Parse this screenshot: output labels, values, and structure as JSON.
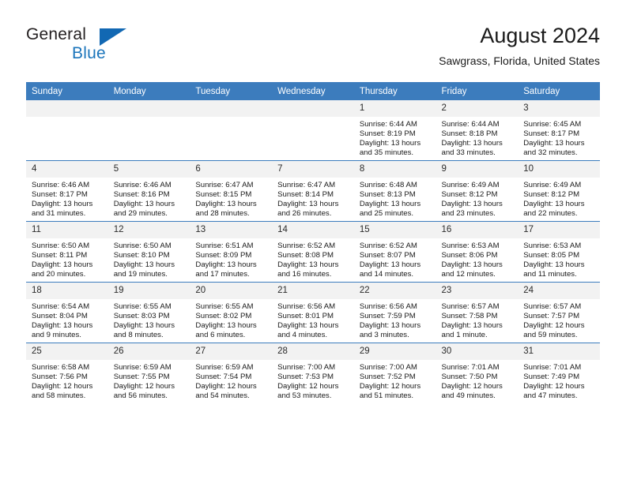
{
  "logo": {
    "word1": "General",
    "word2": "Blue",
    "triangle_color": "#1268b3",
    "blue_color": "#1b75bb"
  },
  "header": {
    "title": "August 2024",
    "subtitle": "Sawgrass, Florida, United States"
  },
  "theme": {
    "header_bar": "#3c7cbd",
    "daynum_band": "#f2f2f2",
    "text": "#1a1a1a"
  },
  "weekdays": [
    "Sunday",
    "Monday",
    "Tuesday",
    "Wednesday",
    "Thursday",
    "Friday",
    "Saturday"
  ],
  "weeks": [
    [
      {
        "day": "",
        "sunrise": "",
        "sunset": "",
        "daylight": "",
        "empty": true
      },
      {
        "day": "",
        "sunrise": "",
        "sunset": "",
        "daylight": "",
        "empty": true
      },
      {
        "day": "",
        "sunrise": "",
        "sunset": "",
        "daylight": "",
        "empty": true
      },
      {
        "day": "",
        "sunrise": "",
        "sunset": "",
        "daylight": "",
        "empty": true
      },
      {
        "day": "1",
        "sunrise": "Sunrise: 6:44 AM",
        "sunset": "Sunset: 8:19 PM",
        "daylight": "Daylight: 13 hours and 35 minutes."
      },
      {
        "day": "2",
        "sunrise": "Sunrise: 6:44 AM",
        "sunset": "Sunset: 8:18 PM",
        "daylight": "Daylight: 13 hours and 33 minutes."
      },
      {
        "day": "3",
        "sunrise": "Sunrise: 6:45 AM",
        "sunset": "Sunset: 8:17 PM",
        "daylight": "Daylight: 13 hours and 32 minutes."
      }
    ],
    [
      {
        "day": "4",
        "sunrise": "Sunrise: 6:46 AM",
        "sunset": "Sunset: 8:17 PM",
        "daylight": "Daylight: 13 hours and 31 minutes."
      },
      {
        "day": "5",
        "sunrise": "Sunrise: 6:46 AM",
        "sunset": "Sunset: 8:16 PM",
        "daylight": "Daylight: 13 hours and 29 minutes."
      },
      {
        "day": "6",
        "sunrise": "Sunrise: 6:47 AM",
        "sunset": "Sunset: 8:15 PM",
        "daylight": "Daylight: 13 hours and 28 minutes."
      },
      {
        "day": "7",
        "sunrise": "Sunrise: 6:47 AM",
        "sunset": "Sunset: 8:14 PM",
        "daylight": "Daylight: 13 hours and 26 minutes."
      },
      {
        "day": "8",
        "sunrise": "Sunrise: 6:48 AM",
        "sunset": "Sunset: 8:13 PM",
        "daylight": "Daylight: 13 hours and 25 minutes."
      },
      {
        "day": "9",
        "sunrise": "Sunrise: 6:49 AM",
        "sunset": "Sunset: 8:12 PM",
        "daylight": "Daylight: 13 hours and 23 minutes."
      },
      {
        "day": "10",
        "sunrise": "Sunrise: 6:49 AM",
        "sunset": "Sunset: 8:12 PM",
        "daylight": "Daylight: 13 hours and 22 minutes."
      }
    ],
    [
      {
        "day": "11",
        "sunrise": "Sunrise: 6:50 AM",
        "sunset": "Sunset: 8:11 PM",
        "daylight": "Daylight: 13 hours and 20 minutes."
      },
      {
        "day": "12",
        "sunrise": "Sunrise: 6:50 AM",
        "sunset": "Sunset: 8:10 PM",
        "daylight": "Daylight: 13 hours and 19 minutes."
      },
      {
        "day": "13",
        "sunrise": "Sunrise: 6:51 AM",
        "sunset": "Sunset: 8:09 PM",
        "daylight": "Daylight: 13 hours and 17 minutes."
      },
      {
        "day": "14",
        "sunrise": "Sunrise: 6:52 AM",
        "sunset": "Sunset: 8:08 PM",
        "daylight": "Daylight: 13 hours and 16 minutes."
      },
      {
        "day": "15",
        "sunrise": "Sunrise: 6:52 AM",
        "sunset": "Sunset: 8:07 PM",
        "daylight": "Daylight: 13 hours and 14 minutes."
      },
      {
        "day": "16",
        "sunrise": "Sunrise: 6:53 AM",
        "sunset": "Sunset: 8:06 PM",
        "daylight": "Daylight: 13 hours and 12 minutes."
      },
      {
        "day": "17",
        "sunrise": "Sunrise: 6:53 AM",
        "sunset": "Sunset: 8:05 PM",
        "daylight": "Daylight: 13 hours and 11 minutes."
      }
    ],
    [
      {
        "day": "18",
        "sunrise": "Sunrise: 6:54 AM",
        "sunset": "Sunset: 8:04 PM",
        "daylight": "Daylight: 13 hours and 9 minutes."
      },
      {
        "day": "19",
        "sunrise": "Sunrise: 6:55 AM",
        "sunset": "Sunset: 8:03 PM",
        "daylight": "Daylight: 13 hours and 8 minutes."
      },
      {
        "day": "20",
        "sunrise": "Sunrise: 6:55 AM",
        "sunset": "Sunset: 8:02 PM",
        "daylight": "Daylight: 13 hours and 6 minutes."
      },
      {
        "day": "21",
        "sunrise": "Sunrise: 6:56 AM",
        "sunset": "Sunset: 8:01 PM",
        "daylight": "Daylight: 13 hours and 4 minutes."
      },
      {
        "day": "22",
        "sunrise": "Sunrise: 6:56 AM",
        "sunset": "Sunset: 7:59 PM",
        "daylight": "Daylight: 13 hours and 3 minutes."
      },
      {
        "day": "23",
        "sunrise": "Sunrise: 6:57 AM",
        "sunset": "Sunset: 7:58 PM",
        "daylight": "Daylight: 13 hours and 1 minute."
      },
      {
        "day": "24",
        "sunrise": "Sunrise: 6:57 AM",
        "sunset": "Sunset: 7:57 PM",
        "daylight": "Daylight: 12 hours and 59 minutes."
      }
    ],
    [
      {
        "day": "25",
        "sunrise": "Sunrise: 6:58 AM",
        "sunset": "Sunset: 7:56 PM",
        "daylight": "Daylight: 12 hours and 58 minutes."
      },
      {
        "day": "26",
        "sunrise": "Sunrise: 6:59 AM",
        "sunset": "Sunset: 7:55 PM",
        "daylight": "Daylight: 12 hours and 56 minutes."
      },
      {
        "day": "27",
        "sunrise": "Sunrise: 6:59 AM",
        "sunset": "Sunset: 7:54 PM",
        "daylight": "Daylight: 12 hours and 54 minutes."
      },
      {
        "day": "28",
        "sunrise": "Sunrise: 7:00 AM",
        "sunset": "Sunset: 7:53 PM",
        "daylight": "Daylight: 12 hours and 53 minutes."
      },
      {
        "day": "29",
        "sunrise": "Sunrise: 7:00 AM",
        "sunset": "Sunset: 7:52 PM",
        "daylight": "Daylight: 12 hours and 51 minutes."
      },
      {
        "day": "30",
        "sunrise": "Sunrise: 7:01 AM",
        "sunset": "Sunset: 7:50 PM",
        "daylight": "Daylight: 12 hours and 49 minutes."
      },
      {
        "day": "31",
        "sunrise": "Sunrise: 7:01 AM",
        "sunset": "Sunset: 7:49 PM",
        "daylight": "Daylight: 12 hours and 47 minutes."
      }
    ]
  ]
}
